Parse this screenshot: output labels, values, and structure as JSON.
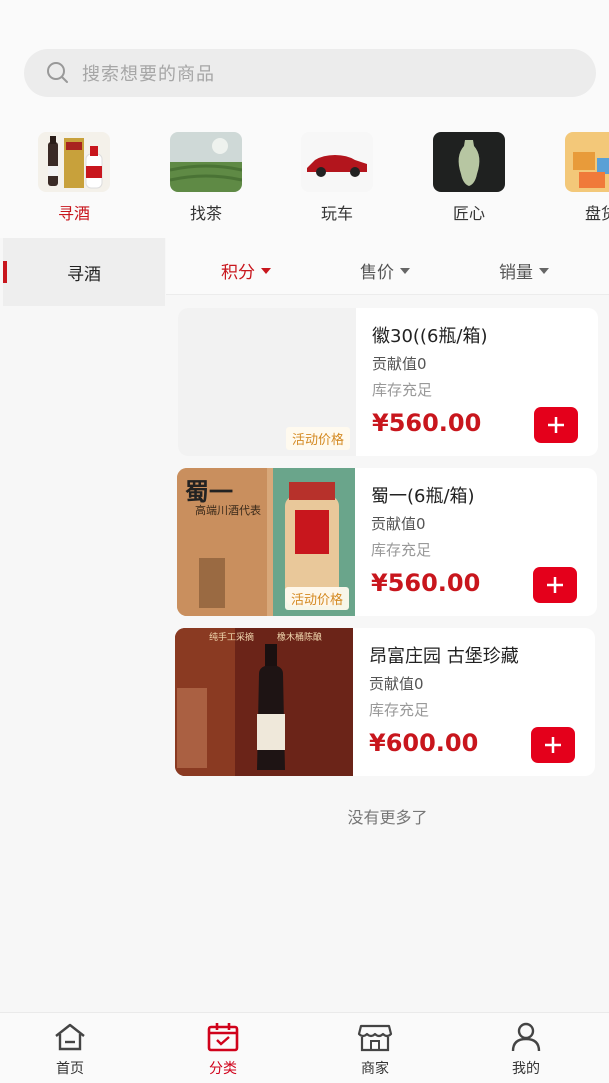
{
  "search": {
    "placeholder": "搜索想要的商品"
  },
  "categories": [
    {
      "label": "寻酒",
      "active": true
    },
    {
      "label": "找茶",
      "active": false
    },
    {
      "label": "玩车",
      "active": false
    },
    {
      "label": "匠心",
      "active": false
    },
    {
      "label": "盘货",
      "active": false
    }
  ],
  "sidebar": {
    "items": [
      {
        "label": "寻酒",
        "active": true
      }
    ]
  },
  "sort": [
    {
      "label": "积分",
      "active": true
    },
    {
      "label": "售价",
      "active": false
    },
    {
      "label": "销量",
      "active": false
    }
  ],
  "products": [
    {
      "name": "徽30((6瓶/箱)",
      "contribution": "贡献值0",
      "stock": "库存充足",
      "price": "¥560.00",
      "badge": "活动价格"
    },
    {
      "name": "蜀一(6瓶/箱)",
      "contribution": "贡献值0",
      "stock": "库存充足",
      "price": "¥560.00",
      "badge": "活动价格",
      "image_text": "蜀一",
      "image_subtext": "高端川酒代表"
    },
    {
      "name": "昂富庄园 古堡珍藏",
      "contribution": "贡献值0",
      "stock": "库存充足",
      "price": "¥600.00",
      "image_text_left": "纯手工采摘",
      "image_text_right": "橡木桶陈酿"
    }
  ],
  "end_text": "没有更多了",
  "tabbar": [
    {
      "label": "首页",
      "icon": "home-icon",
      "active": false
    },
    {
      "label": "分类",
      "icon": "calendar-icon",
      "active": true
    },
    {
      "label": "商家",
      "icon": "store-icon",
      "active": false
    },
    {
      "label": "我的",
      "icon": "user-icon",
      "active": false
    }
  ],
  "colors": {
    "accent": "#c8161d",
    "add_button": "#e4001b",
    "badge_text": "#d48a22"
  }
}
